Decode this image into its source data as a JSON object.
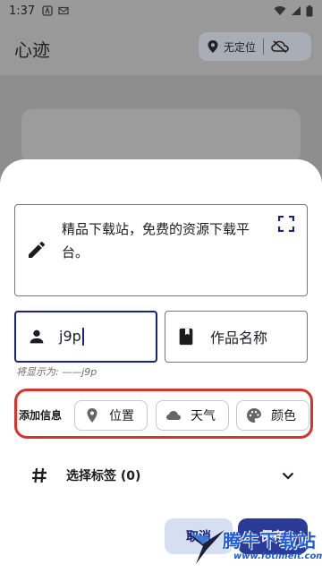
{
  "status_bar": {
    "time": "1:37"
  },
  "app": {
    "title": "心迹",
    "location_chip": "无定位"
  },
  "sheet": {
    "content": "精品下载站，免费的资源下载平台。",
    "author_value": "j9p",
    "work_placeholder": "作品名称",
    "display_hint": "将显示为: ——j9p",
    "add_info": {
      "label": "添加信息",
      "chips": [
        "位置",
        "天气",
        "颜色"
      ]
    },
    "tags_label": "选择标签 (0)",
    "cancel_label": "取消",
    "save_label": "保存"
  },
  "watermark": {
    "title": "腾牛下载站",
    "url": "www.fotimeit.com"
  },
  "colors": {
    "primary": "#2b3a96",
    "tonal": "#d6def2",
    "highlight": "#d6332b"
  }
}
